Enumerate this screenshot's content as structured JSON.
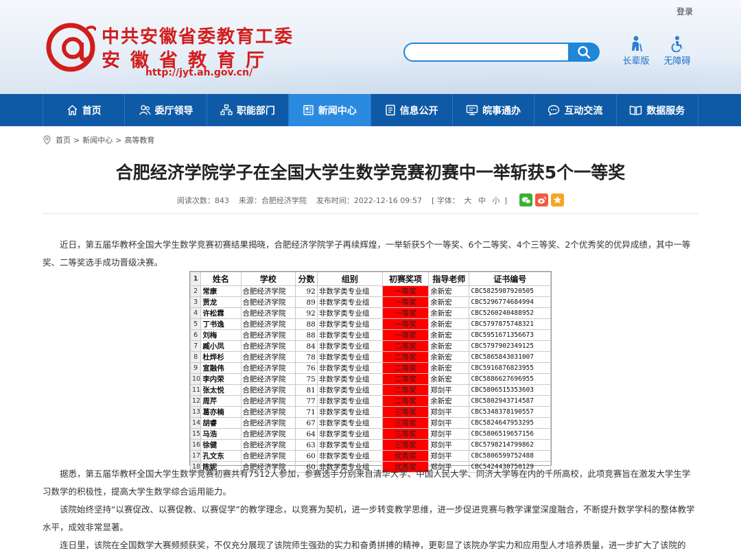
{
  "header": {
    "login": "登录",
    "logo_line1": "中共安徽省委教育工委",
    "logo_line2": "安徽省教育厅",
    "logo_url": "http://jyt.ah.gov.cn/",
    "search_placeholder": "",
    "quick_links": [
      {
        "label": "长辈版",
        "icon": "elder-icon"
      },
      {
        "label": "无障碍",
        "icon": "accessibility-icon"
      }
    ]
  },
  "nav": [
    {
      "label": "首页",
      "icon": "home-icon",
      "active": false
    },
    {
      "label": "委厅领导",
      "icon": "leaders-icon",
      "active": false
    },
    {
      "label": "职能部门",
      "icon": "departments-icon",
      "active": false
    },
    {
      "label": "新闻中心",
      "icon": "news-icon",
      "active": true
    },
    {
      "label": "信息公开",
      "icon": "info-icon",
      "active": false
    },
    {
      "label": "皖事通办",
      "icon": "service-icon",
      "active": false
    },
    {
      "label": "互动交流",
      "icon": "chat-icon",
      "active": false
    },
    {
      "label": "数据服务",
      "icon": "data-icon",
      "active": false
    }
  ],
  "breadcrumb": [
    "首页",
    "新闻中心",
    "高等教育"
  ],
  "article": {
    "title": "合肥经济学院学子在全国大学生数学竞赛初赛中一举斩获5个一等奖",
    "views": "阅读次数：843",
    "source": "来源：合肥经济学院",
    "published": "发布时间：2022-12-16 09:57",
    "font_label_open": "[ 字体：",
    "font_sizes": [
      "大",
      "中",
      "小"
    ],
    "font_label_close": "]",
    "p1": "近日，第五届华教杯全国大学生数学竞赛初赛结果揭晓，合肥经济学院学子再续辉煌，一举斩获5个一等奖、6个二等奖、4个三等奖、2个优秀奖的优异成绩，其中一等奖、二等奖选手成功晋级决赛。",
    "p2": "据悉，第五届华教杯全国大学生数学竞赛初赛共有7512人参加，参赛选手分别来自清华大学、中国人民大学、同济大学等在内的千所高校，此项竞赛旨在激发大学生学习数学的积极性，提高大学生数学综合运用能力。",
    "p3": "该院始终坚持“以赛促改、以赛促教、以赛促学”的教学理念，以竞赛为契机，进一步转变教学思维，进一步促进竞赛与教学课堂深度融合，不断提升数学学科的整体教学水平，成效非常显著。",
    "p4": "连日里，该院在全国数学大赛频频获奖，不仅充分展现了该院师生强劲的实力和奋勇拼搏的精神，更彰显了该院办学实力和应用型人才培养质量，进一步扩大了该院的"
  },
  "colors": {
    "nav_bg": "#0f5aa6",
    "nav_active": "#2a8ae0",
    "logo_red": "#d21d1d",
    "award_red": "#ff0000"
  },
  "results_table": {
    "headers": [
      "姓名",
      "学校",
      "分数",
      "组别",
      "初赛奖项",
      "指导老师",
      "证书编号"
    ],
    "rows": [
      [
        "常康",
        "合肥经济学院",
        "92",
        "非数学类专业组",
        "一等奖",
        "余新宏",
        "CBC5825987920505"
      ],
      [
        "贾龙",
        "合肥经济学院",
        "89",
        "非数学类专业组",
        "一等奖",
        "余新宏",
        "CBC5296774684994"
      ],
      [
        "许松霖",
        "合肥经济学院",
        "92",
        "非数学类专业组",
        "一等奖",
        "余新宏",
        "CBC5260240488952"
      ],
      [
        "丁书逸",
        "合肥经济学院",
        "88",
        "非数学类专业组",
        "一等奖",
        "余新宏",
        "CBC5797875748321"
      ],
      [
        "刘梅",
        "合肥经济学院",
        "88",
        "非数学类专业组",
        "一等奖",
        "余新宏",
        "CBC5951671356673"
      ],
      [
        "臧小凤",
        "合肥经济学院",
        "84",
        "非数学类专业组",
        "二等奖",
        "余新宏",
        "CBC5797902349125"
      ],
      [
        "杜烨杉",
        "合肥经济学院",
        "78",
        "非数学类专业组",
        "二等奖",
        "余新宏",
        "CBC5865843031007"
      ],
      [
        "宣融伟",
        "合肥经济学院",
        "76",
        "非数学类专业组",
        "二等奖",
        "余新宏",
        "CBC5916876823955"
      ],
      [
        "李内荣",
        "合肥经济学院",
        "75",
        "非数学类专业组",
        "二等奖",
        "余新宏",
        "CBC5886627696955"
      ],
      [
        "张太悦",
        "合肥经济学院",
        "81",
        "非数学类专业组",
        "二等奖",
        "郑剑平",
        "CBC5806515353603"
      ],
      [
        "周芹",
        "合肥经济学院",
        "77",
        "非数学类专业组",
        "二等奖",
        "余新宏",
        "CBC5802943714587"
      ],
      [
        "葛亦楠",
        "合肥经济学院",
        "71",
        "非数学类专业组",
        "三等奖",
        "郑剑平",
        "CBC5348378190557"
      ],
      [
        "胡睿",
        "合肥经济学院",
        "67",
        "非数学类专业组",
        "三等奖",
        "郑剑平",
        "CBC5824647953295"
      ],
      [
        "马浩",
        "合肥经济学院",
        "64",
        "非数学类专业组",
        "三等奖",
        "郑剑平",
        "CBC5806519657156"
      ],
      [
        "徐健",
        "合肥经济学院",
        "63",
        "非数学类专业组",
        "三等奖",
        "郑剑平",
        "CBC5798214799862"
      ],
      [
        "孔文东",
        "合肥经济学院",
        "60",
        "非数学类专业组",
        "优秀奖",
        "郑剑平",
        "CBC5806599752488"
      ],
      [
        "陈妮",
        "合肥经济学院",
        "60",
        "非数学类专业组",
        "优秀奖",
        "郑剑平",
        "CBC5424430750129"
      ]
    ]
  }
}
